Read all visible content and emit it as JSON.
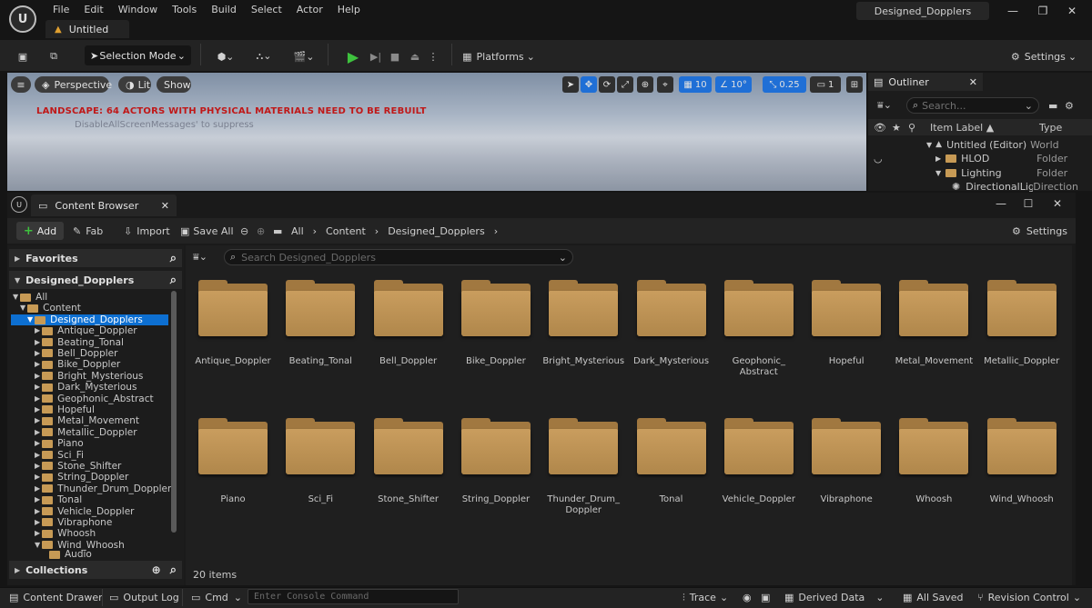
{
  "menu": [
    "File",
    "Edit",
    "Window",
    "Tools",
    "Build",
    "Select",
    "Actor",
    "Help"
  ],
  "project_tab": "Untitled",
  "window_name": "Designed_Dopplers",
  "toolbar": {
    "selection_mode": "Selection Mode",
    "platforms": "Platforms",
    "settings": "Settings"
  },
  "viewport": {
    "perspective": "Perspective",
    "lit": "Lit",
    "show": "Show",
    "grid_snap": "10",
    "rot_snap": "10°",
    "scale_snap": "0.25",
    "camera_speed": "1",
    "warning": "LANDSCAPE: 64 ACTORS WITH PHYSICAL MATERIALS NEED TO BE REBUILT",
    "suppress_hint": "DisableAllScreenMessages' to suppress"
  },
  "outliner": {
    "title": "Outliner",
    "search_placeholder": "Search...",
    "col_label": "Item Label ▲",
    "col_type": "Type",
    "rows": [
      {
        "label": "Untitled (Editor)",
        "type": "World"
      },
      {
        "label": "HLOD",
        "type": "Folder"
      },
      {
        "label": "Lighting",
        "type": "Folder"
      },
      {
        "label": "DirectionalLig",
        "type": "Direction"
      }
    ]
  },
  "content_browser": {
    "title": "Content Browser",
    "add": "Add",
    "fab": "Fab",
    "import": "Import",
    "save_all": "Save All",
    "breadcrumb": [
      "All",
      "Content",
      "Designed_Dopplers"
    ],
    "settings": "Settings",
    "search_placeholder": "Search Designed_Dopplers",
    "items_count": "20 items"
  },
  "sidebar": {
    "favorites": "Favorites",
    "root": "Designed_Dopplers",
    "collections": "Collections",
    "tree": {
      "all": "All",
      "content": "Content",
      "selected": "Designed_Dopplers",
      "children": [
        "Antique_Doppler",
        "Beating_Tonal",
        "Bell_Doppler",
        "Bike_Doppler",
        "Bright_Mysterious",
        "Dark_Mysterious",
        "Geophonic_Abstract",
        "Hopeful",
        "Metal_Movement",
        "Metallic_Doppler",
        "Piano",
        "Sci_Fi",
        "Stone_Shifter",
        "String_Doppler",
        "Thunder_Drum_Doppler",
        "Tonal",
        "Vehicle_Doppler",
        "Vibraphone",
        "Whoosh",
        "Wind_Whoosh"
      ],
      "grandchild": "Audio"
    }
  },
  "folders": [
    {
      "line1": "Antique_Doppler",
      "line2": ""
    },
    {
      "line1": "Beating_Tonal",
      "line2": ""
    },
    {
      "line1": "Bell_Doppler",
      "line2": ""
    },
    {
      "line1": "Bike_Doppler",
      "line2": ""
    },
    {
      "line1": "Bright_Mysterious",
      "line2": ""
    },
    {
      "line1": "Dark_Mysterious",
      "line2": ""
    },
    {
      "line1": "Geophonic_",
      "line2": "Abstract"
    },
    {
      "line1": "Hopeful",
      "line2": ""
    },
    {
      "line1": "Metal_Movement",
      "line2": ""
    },
    {
      "line1": "Metallic_Doppler",
      "line2": ""
    },
    {
      "line1": "Piano",
      "line2": ""
    },
    {
      "line1": "Sci_Fi",
      "line2": ""
    },
    {
      "line1": "Stone_Shifter",
      "line2": ""
    },
    {
      "line1": "String_Doppler",
      "line2": ""
    },
    {
      "line1": "Thunder_Drum_",
      "line2": "Doppler"
    },
    {
      "line1": "Tonal",
      "line2": ""
    },
    {
      "line1": "Vehicle_Doppler",
      "line2": ""
    },
    {
      "line1": "Vibraphone",
      "line2": ""
    },
    {
      "line1": "Whoosh",
      "line2": ""
    },
    {
      "line1": "Wind_Whoosh",
      "line2": ""
    }
  ],
  "statusbar": {
    "content_drawer": "Content Drawer",
    "output_log": "Output Log",
    "cmd": "Cmd",
    "console_placeholder": "Enter Console Command",
    "trace": "Trace",
    "derived_data": "Derived Data",
    "all_saved": "All Saved",
    "revision_control": "Revision Control"
  },
  "colors": {
    "accent_blue": "#0d6fd1",
    "folder": "#c99d5e",
    "play_green": "#3ec23e",
    "warning_red": "#c01818"
  }
}
